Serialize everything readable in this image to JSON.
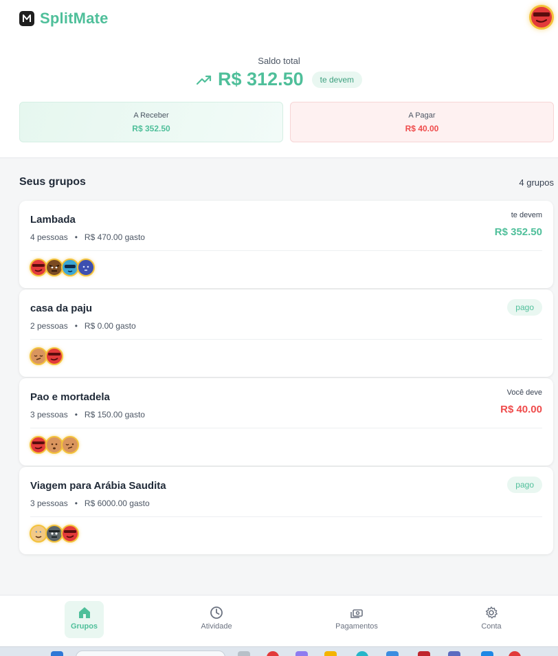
{
  "app": {
    "name": "SplitMate"
  },
  "balance": {
    "label": "Saldo total",
    "amount": "R$ 312.50",
    "badge": "te devem",
    "receive": {
      "label": "A Receber",
      "value": "R$ 352.50"
    },
    "pay": {
      "label": "A Pagar",
      "value": "R$ 40.00"
    }
  },
  "groups_section": {
    "title": "Seus grupos",
    "count": "4 grupos"
  },
  "groups": [
    {
      "name": "Lambada",
      "people": "4 pessoas",
      "spent": "R$ 470.00 gasto",
      "status": "te devem",
      "amount": "R$ 352.50"
    },
    {
      "name": "casa da paju",
      "people": "2 pessoas",
      "spent": "R$ 0.00 gasto",
      "status": "pago"
    },
    {
      "name": "Pao e mortadela",
      "people": "3 pessoas",
      "spent": "R$ 150.00 gasto",
      "status": "Você deve",
      "amount": "R$ 40.00"
    },
    {
      "name": "Viagem para Arábia Saudita",
      "people": "3 pessoas",
      "spent": "R$ 6000.00 gasto",
      "status": "pago"
    }
  ],
  "nav": [
    {
      "label": "Grupos",
      "icon": "home-icon",
      "active": true
    },
    {
      "label": "Atividade",
      "icon": "clock-icon"
    },
    {
      "label": "Pagamentos",
      "icon": "payments-icon"
    },
    {
      "label": "Conta",
      "icon": "gear-icon"
    }
  ],
  "colors": {
    "accent": "#4fbf9a",
    "negative": "#ef4b4b",
    "avatar_ring": "#f4c23a"
  }
}
